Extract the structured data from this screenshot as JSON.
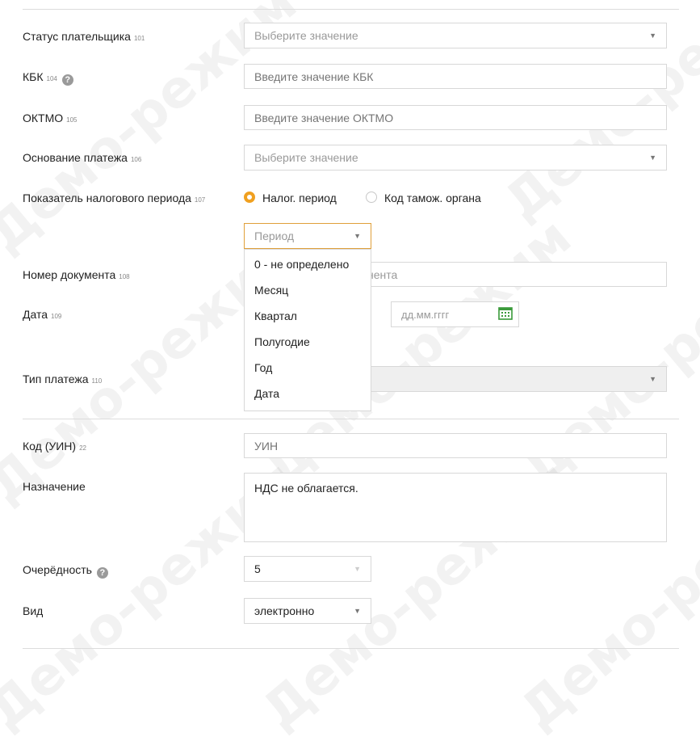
{
  "watermark": "Демо-режим",
  "fields": {
    "payer_status": {
      "label": "Статус плательщика",
      "code": "101",
      "placeholder": "Выберите значение"
    },
    "kbk": {
      "label": "КБК",
      "code": "104",
      "placeholder": "Введите значение КБК"
    },
    "oktmo": {
      "label": "ОКТМО",
      "code": "105",
      "placeholder": "Введите значение ОКТМО"
    },
    "payment_basis": {
      "label": "Основание платежа",
      "code": "106",
      "placeholder": "Выберите значение"
    },
    "tax_period": {
      "label": "Показатель налогового периода",
      "code": "107",
      "radio_tax_period": "Налог. период",
      "radio_customs_code": "Код тамож. органа",
      "period_select": "Период",
      "options": [
        "0 - не определено",
        "Месяц",
        "Квартал",
        "Полугодие",
        "Год",
        "Дата"
      ]
    },
    "doc_number": {
      "label": "Номер документа",
      "code": "108",
      "placeholder_visible": "нента"
    },
    "date": {
      "label": "Дата",
      "code": "109",
      "placeholder": "дд.мм.гггг"
    },
    "payment_type": {
      "label": "Тип платежа",
      "code": "110"
    },
    "uin": {
      "label": "Код (УИН)",
      "code": "22",
      "placeholder": "УИН"
    },
    "purpose": {
      "label": "Назначение",
      "value": "НДС не облагается."
    },
    "priority": {
      "label": "Очерёдность",
      "value": "5"
    },
    "kind": {
      "label": "Вид",
      "value": "электронно"
    }
  },
  "colors": {
    "accent": "#f0a020",
    "calendar": "#3a9a3a"
  }
}
